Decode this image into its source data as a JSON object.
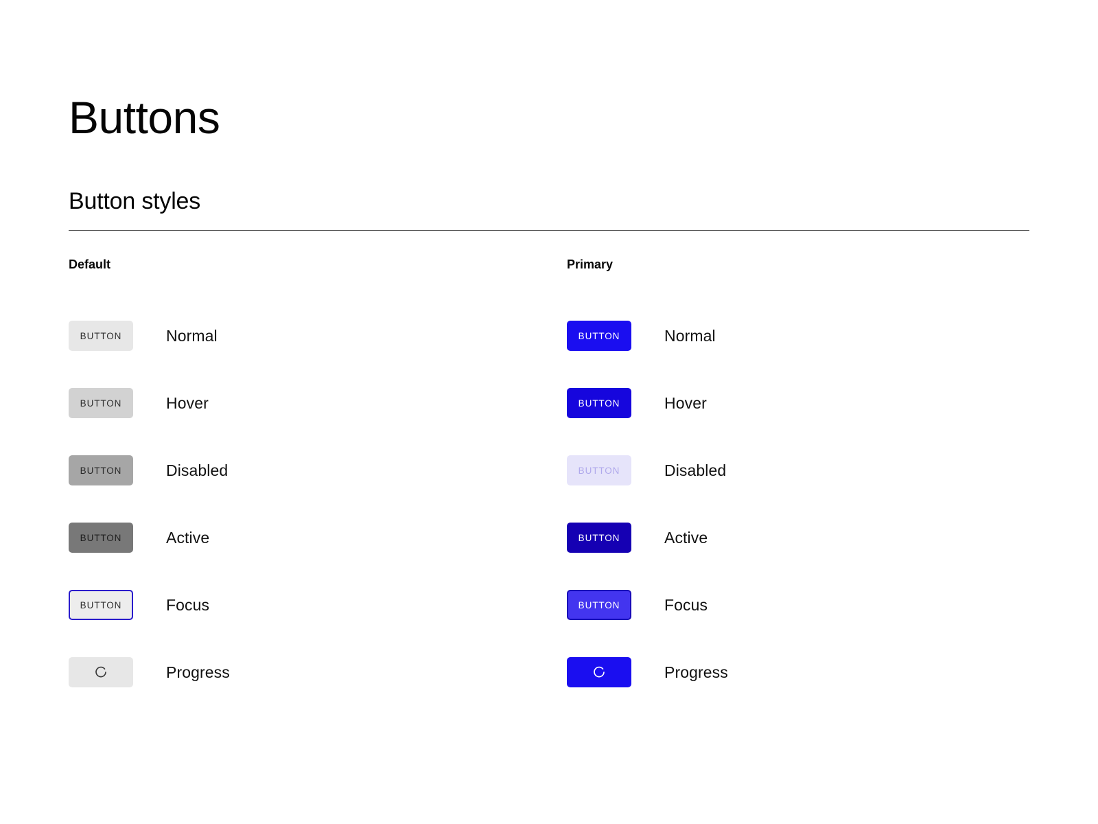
{
  "page": {
    "title": "Buttons",
    "section_title": "Button styles"
  },
  "theme": {
    "background": "#ffffff",
    "text": "#111111",
    "divider": "#4c4c4c",
    "accent_blue": "#1a0ef0",
    "focus_ring": "#2a1ccc"
  },
  "button_label": "BUTTON",
  "columns": [
    {
      "id": "default",
      "title": "Default",
      "rows": [
        {
          "state": "Normal",
          "variant": "default-normal",
          "kind": "text",
          "fill": "#e7e7e7",
          "label_color": "#2f2f2f"
        },
        {
          "state": "Hover",
          "variant": "default-hover",
          "kind": "text",
          "fill": "#d2d2d2",
          "label_color": "#2f2f2f"
        },
        {
          "state": "Disabled",
          "variant": "default-disabled",
          "kind": "text",
          "fill": "#a6a6a6",
          "label_color": "#2a2a2a"
        },
        {
          "state": "Active",
          "variant": "default-active",
          "kind": "text",
          "fill": "#787878",
          "label_color": "#1e1e1e"
        },
        {
          "state": "Focus",
          "variant": "default-focus",
          "kind": "text",
          "fill": "#ededed",
          "label_color": "#2f2f2f",
          "border": "#2a1ccc"
        },
        {
          "state": "Progress",
          "variant": "default-progress",
          "kind": "spinner",
          "fill": "#e7e7e7",
          "spinner_color": "#3a3a3a"
        }
      ]
    },
    {
      "id": "primary",
      "title": "Primary",
      "rows": [
        {
          "state": "Normal",
          "variant": "primary-normal",
          "kind": "text",
          "fill": "#1a0ef0",
          "label_color": "#ffffff"
        },
        {
          "state": "Hover",
          "variant": "primary-hover",
          "kind": "text",
          "fill": "#1606dd",
          "label_color": "#ffffff"
        },
        {
          "state": "Disabled",
          "variant": "primary-disabled",
          "kind": "text",
          "fill": "#e6e4fa",
          "label_color": "#b0a9ec"
        },
        {
          "state": "Active",
          "variant": "primary-active",
          "kind": "text",
          "fill": "#1500b3",
          "label_color": "#ffffff"
        },
        {
          "state": "Focus",
          "variant": "primary-focus",
          "kind": "text",
          "fill": "#4335ef",
          "label_color": "#ffffff",
          "border": "#190bb9"
        },
        {
          "state": "Progress",
          "variant": "primary-progress",
          "kind": "spinner",
          "fill": "#1a0ef0",
          "spinner_color": "#ffffff"
        }
      ]
    }
  ]
}
